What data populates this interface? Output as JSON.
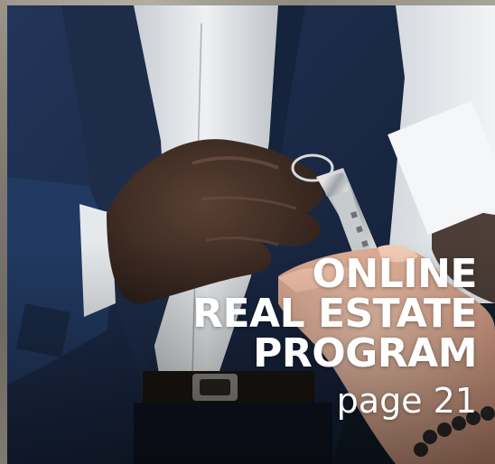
{
  "headline": {
    "line1": "ONLINE",
    "line2": "REAL ESTATE",
    "line3": "PROGRAM"
  },
  "page_ref": "page 21",
  "colors": {
    "suit": "#1b2a44",
    "shirt": "#d9dde0",
    "skin_dark": "#3a2a22",
    "skin_light": "#e8b49a",
    "text": "#ffffff"
  }
}
